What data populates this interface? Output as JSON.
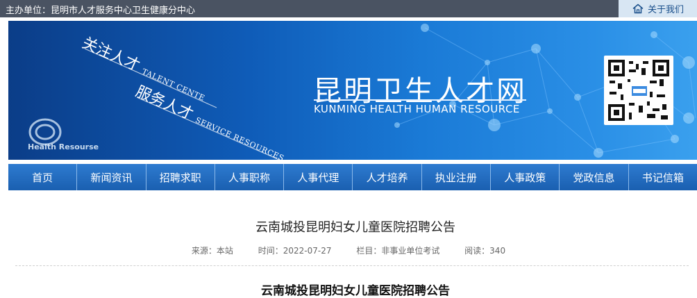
{
  "topbar": {
    "host_text": "主办单位：昆明市人才服务中心卫生健康分中心",
    "about_label": "关于我们",
    "about_icon": "home-icon"
  },
  "banner": {
    "cn_title": "昆明卫生人才网",
    "en_title": "KUNMING HEALTH HUMAN RESOURCE",
    "slogan1_cn": "关注人才",
    "slogan1_en": "TALENT CENTE",
    "slogan2_cn": "服务人才",
    "slogan2_en": "SERVICE RESOURCES",
    "logo_text": "Health Resourse",
    "qr_icon": "qr-code"
  },
  "nav": {
    "items": [
      "首页",
      "新闻资讯",
      "招聘求职",
      "人事职称",
      "人事代理",
      "人才培养",
      "执业注册",
      "人事政策",
      "党政信息",
      "书记信箱"
    ]
  },
  "article": {
    "title": "云南城投昆明妇女儿童医院招聘公告",
    "source": "来源：本站",
    "time": "时间：2022-07-27",
    "column": "栏目：非事业单位考试",
    "reads": "阅读：340",
    "body_title": "云南城投昆明妇女儿童医院招聘公告"
  },
  "colors": {
    "topbar": "#4a5362",
    "about_bg": "#d8e6f3",
    "nav": "#2268bd",
    "banner_dark": "#0b3d88",
    "banner_light": "#3aa0ee"
  }
}
